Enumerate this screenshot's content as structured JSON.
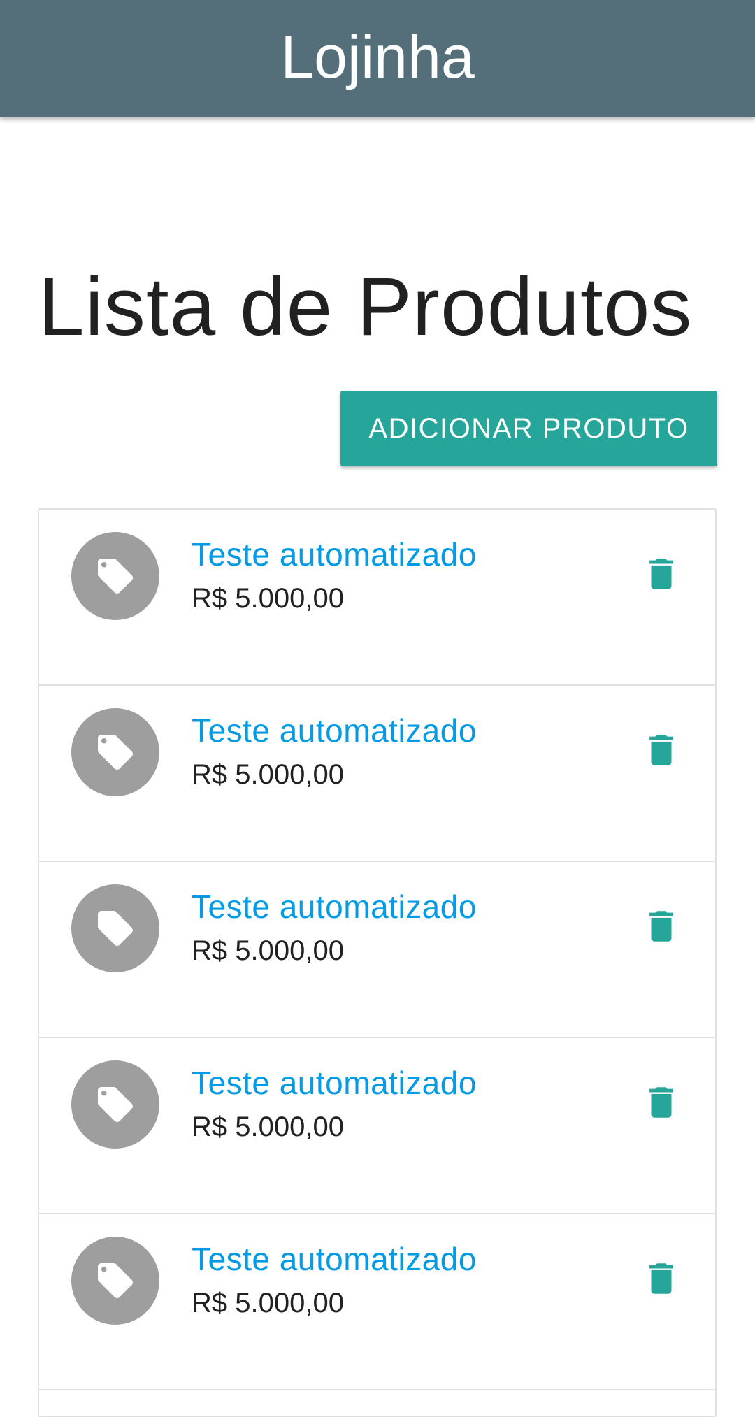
{
  "app_bar": {
    "title": "Lojinha"
  },
  "page": {
    "title": "Lista de Produtos"
  },
  "actions": {
    "add_product_label": "ADICIONAR PRODUTO"
  },
  "products": [
    {
      "name": "Teste automatizado",
      "price": "R$ 5.000,00",
      "icon": "tag-icon",
      "action_icon": "delete-icon"
    },
    {
      "name": "Teste automatizado",
      "price": "R$ 5.000,00",
      "icon": "tag-icon",
      "action_icon": "delete-icon"
    },
    {
      "name": "Teste automatizado",
      "price": "R$ 5.000,00",
      "icon": "tag-icon",
      "action_icon": "delete-icon"
    },
    {
      "name": "Teste automatizado",
      "price": "R$ 5.000,00",
      "icon": "tag-icon",
      "action_icon": "delete-icon"
    },
    {
      "name": "Teste automatizado",
      "price": "R$ 5.000,00",
      "icon": "tag-icon",
      "action_icon": "delete-icon"
    }
  ],
  "colors": {
    "app_bar": "#546e7a",
    "accent": "#26a69a",
    "link": "#039be5",
    "avatar": "#9e9e9e"
  }
}
